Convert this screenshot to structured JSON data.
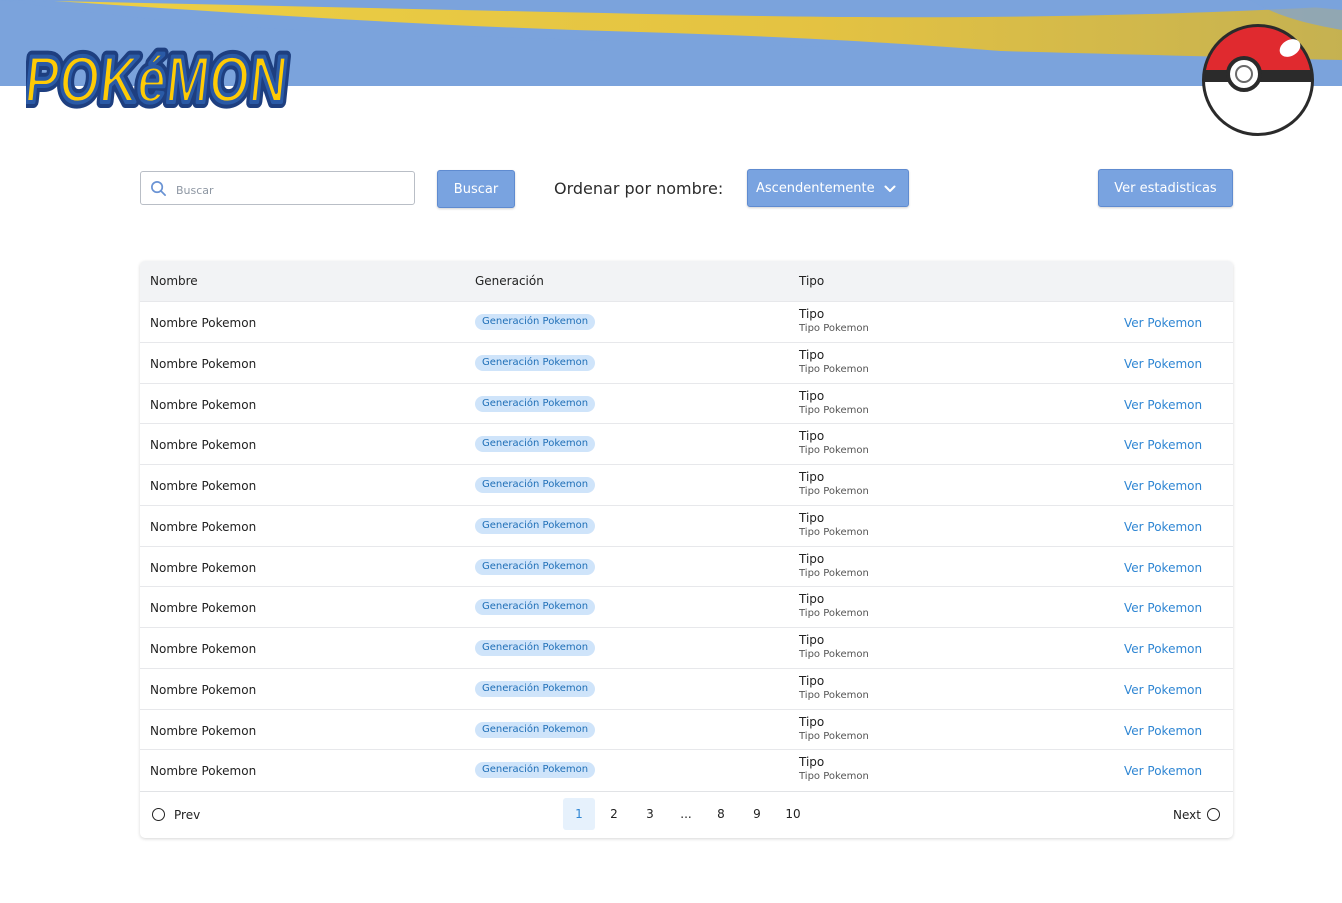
{
  "brand": {
    "logo_text": "POKéMON",
    "colors": {
      "banner_blue": "#7ba3dc",
      "banner_yellow": "#efc83a",
      "accent": "#79a3e0",
      "link": "#2f86d3",
      "badge_bg": "#cfe4fa"
    }
  },
  "toolbar": {
    "search_placeholder": "Buscar",
    "search_button": "Buscar",
    "sort_label": "Ordenar por nombre:",
    "sort_selected": "Ascendentemente",
    "stats_button": "Ver estadisticas"
  },
  "table": {
    "columns": [
      "Nombre",
      "Generación",
      "Tipo"
    ],
    "rows": [
      {
        "name": "Nombre Pokemon",
        "generation": "Generación Pokemon",
        "type": "Tipo",
        "type_sub": "Tipo Pokemon",
        "action": "Ver Pokemon"
      },
      {
        "name": "Nombre Pokemon",
        "generation": "Generación Pokemon",
        "type": "Tipo",
        "type_sub": "Tipo Pokemon",
        "action": "Ver Pokemon"
      },
      {
        "name": "Nombre Pokemon",
        "generation": "Generación Pokemon",
        "type": "Tipo",
        "type_sub": "Tipo Pokemon",
        "action": "Ver Pokemon"
      },
      {
        "name": "Nombre Pokemon",
        "generation": "Generación Pokemon",
        "type": "Tipo",
        "type_sub": "Tipo Pokemon",
        "action": "Ver Pokemon"
      },
      {
        "name": "Nombre Pokemon",
        "generation": "Generación Pokemon",
        "type": "Tipo",
        "type_sub": "Tipo Pokemon",
        "action": "Ver Pokemon"
      },
      {
        "name": "Nombre Pokemon",
        "generation": "Generación Pokemon",
        "type": "Tipo",
        "type_sub": "Tipo Pokemon",
        "action": "Ver Pokemon"
      },
      {
        "name": "Nombre Pokemon",
        "generation": "Generación Pokemon",
        "type": "Tipo",
        "type_sub": "Tipo Pokemon",
        "action": "Ver Pokemon"
      },
      {
        "name": "Nombre Pokemon",
        "generation": "Generación Pokemon",
        "type": "Tipo",
        "type_sub": "Tipo Pokemon",
        "action": "Ver Pokemon"
      },
      {
        "name": "Nombre Pokemon",
        "generation": "Generación Pokemon",
        "type": "Tipo",
        "type_sub": "Tipo Pokemon",
        "action": "Ver Pokemon"
      },
      {
        "name": "Nombre Pokemon",
        "generation": "Generación Pokemon",
        "type": "Tipo",
        "type_sub": "Tipo Pokemon",
        "action": "Ver Pokemon"
      },
      {
        "name": "Nombre Pokemon",
        "generation": "Generación Pokemon",
        "type": "Tipo",
        "type_sub": "Tipo Pokemon",
        "action": "Ver Pokemon"
      },
      {
        "name": "Nombre Pokemon",
        "generation": "Generación Pokemon",
        "type": "Tipo",
        "type_sub": "Tipo Pokemon",
        "action": "Ver Pokemon"
      }
    ]
  },
  "pagination": {
    "prev_label": "Prev",
    "next_label": "Next",
    "pages": [
      "1",
      "2",
      "3",
      "...",
      "8",
      "9",
      "10"
    ],
    "current": "1"
  }
}
